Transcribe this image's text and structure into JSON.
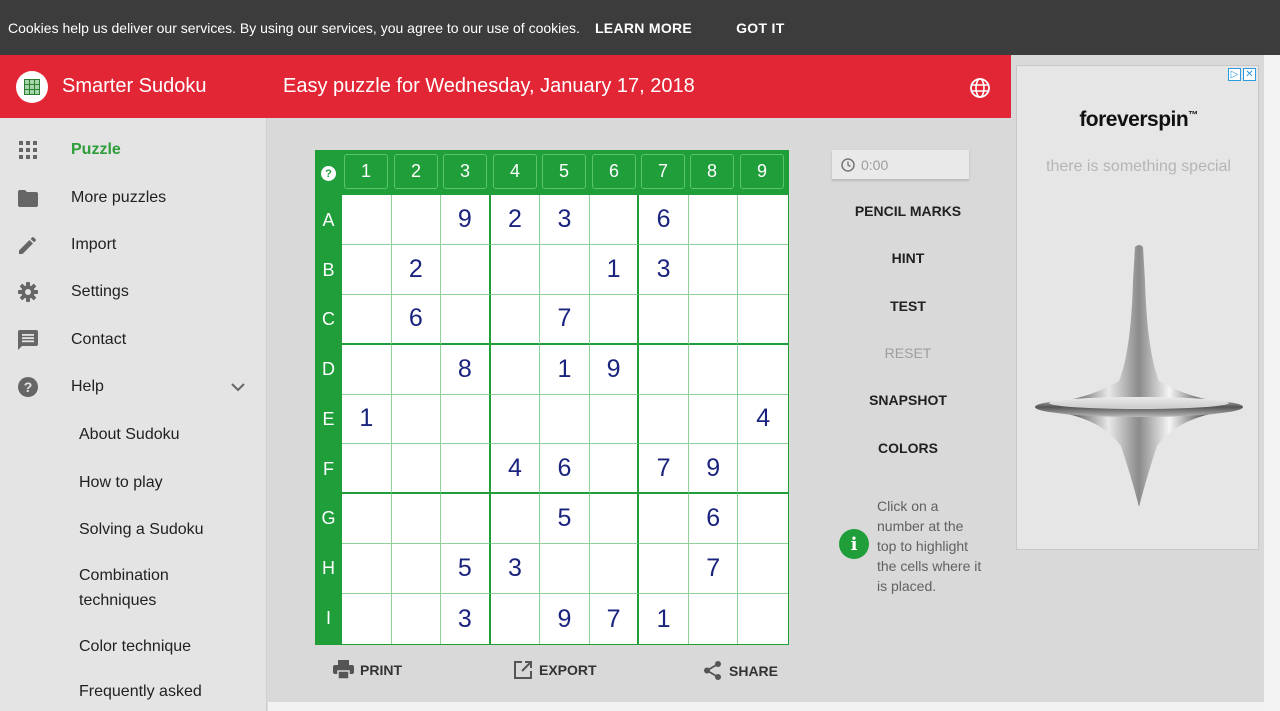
{
  "cookie_bar": {
    "message": "Cookies help us deliver our services. By using our services, you agree to our use of cookies.",
    "learn_more": "LEARN MORE",
    "got_it": "GOT IT"
  },
  "header": {
    "app_title": "Smarter Sudoku",
    "puzzle_title": "Easy puzzle for Wednesday, January 17, 2018"
  },
  "sidebar": {
    "items": [
      {
        "label": "Puzzle",
        "icon": "grid-icon"
      },
      {
        "label": "More puzzles",
        "icon": "folder-icon"
      },
      {
        "label": "Import",
        "icon": "pencil-icon"
      },
      {
        "label": "Settings",
        "icon": "gear-icon"
      },
      {
        "label": "Contact",
        "icon": "chat-icon"
      },
      {
        "label": "Help",
        "icon": "help-icon"
      }
    ],
    "help_subitems": [
      "About Sudoku",
      "How to play",
      "Solving a Sudoku",
      "Combination techniques",
      "Color technique",
      "Frequently asked"
    ]
  },
  "board": {
    "help_symbol": "?",
    "columns": [
      "1",
      "2",
      "3",
      "4",
      "5",
      "6",
      "7",
      "8",
      "9"
    ],
    "rows": [
      "A",
      "B",
      "C",
      "D",
      "E",
      "F",
      "G",
      "H",
      "I"
    ],
    "cells": [
      [
        "",
        "",
        "9",
        "2",
        "3",
        "",
        "6",
        "",
        ""
      ],
      [
        "",
        "2",
        "",
        "",
        "",
        "1",
        "3",
        "",
        ""
      ],
      [
        "",
        "6",
        "",
        "",
        "7",
        "",
        "",
        "",
        ""
      ],
      [
        "",
        "",
        "8",
        "",
        "1",
        "9",
        "",
        "",
        ""
      ],
      [
        "1",
        "",
        "",
        "",
        "",
        "",
        "",
        "",
        "4"
      ],
      [
        "",
        "",
        "",
        "4",
        "6",
        "",
        "7",
        "9",
        ""
      ],
      [
        "",
        "",
        "",
        "",
        "5",
        "",
        "",
        "6",
        ""
      ],
      [
        "",
        "",
        "5",
        "3",
        "",
        "",
        "",
        "7",
        ""
      ],
      [
        "",
        "",
        "3",
        "",
        "9",
        "7",
        "1",
        "",
        ""
      ]
    ]
  },
  "actions": {
    "print": "PRINT",
    "export": "EXPORT",
    "share": "SHARE"
  },
  "controls": {
    "timer": "0:00",
    "pencil_marks": "PENCIL MARKS",
    "hint": "HINT",
    "test": "TEST",
    "reset": "RESET",
    "snapshot": "SNAPSHOT",
    "colors": "COLORS",
    "info_symbol": "i",
    "info_text": "Click on a number at the top to highlight the cells where it is placed."
  },
  "ad": {
    "brand": "foreverspin",
    "trademark": "™",
    "tagline": "there is something special"
  },
  "colors": {
    "header_red": "#e32636",
    "board_green": "#1f9e3a",
    "digit_navy": "#1a237e",
    "active_green": "#2e9e3a"
  }
}
